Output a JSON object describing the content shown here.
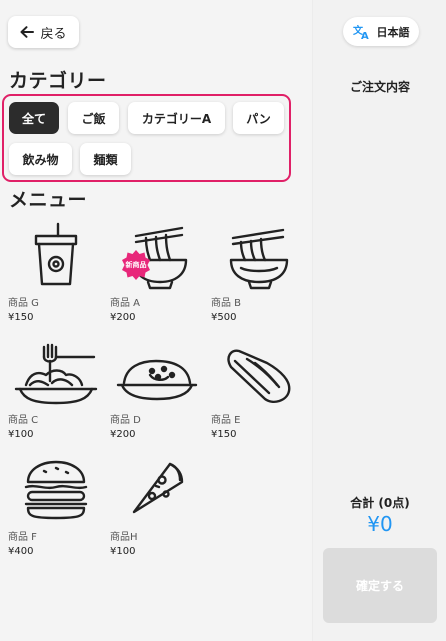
{
  "header": {
    "back_label": "戻る"
  },
  "categories": {
    "title": "カテゴリー",
    "items": [
      {
        "label": "全て",
        "active": true
      },
      {
        "label": "ご飯",
        "active": false
      },
      {
        "label": "カテゴリーA",
        "active": false
      },
      {
        "label": "パン",
        "active": false
      },
      {
        "label": "飲み物",
        "active": false
      },
      {
        "label": "麺類",
        "active": false
      }
    ],
    "highlight_color": "#e02067"
  },
  "menu": {
    "title": "メニュー",
    "items": [
      {
        "name": "商品 G",
        "price": "¥150",
        "icon": "drink-cup-icon"
      },
      {
        "name": "商品 A",
        "price": "¥200",
        "icon": "ramen-bowl-icon",
        "badge": "新商品"
      },
      {
        "name": "商品 B",
        "price": "¥500",
        "icon": "noodle-bowl-icon"
      },
      {
        "name": "商品 C",
        "price": "¥100",
        "icon": "spaghetti-plate-icon"
      },
      {
        "name": "商品 D",
        "price": "¥200",
        "icon": "curry-plate-icon"
      },
      {
        "name": "商品 E",
        "price": "¥150",
        "icon": "bread-loaf-icon"
      },
      {
        "name": "商品 F",
        "price": "¥400",
        "icon": "hamburger-icon"
      },
      {
        "name": "商品H",
        "price": "¥100",
        "icon": "pizza-slice-icon"
      }
    ]
  },
  "sidebar": {
    "language_label": "日本語",
    "order_title": "ご注文内容",
    "total_label": "合計 (0点)",
    "total_value": "¥0",
    "confirm_label": "確定する",
    "accent_color": "#2196f3"
  }
}
